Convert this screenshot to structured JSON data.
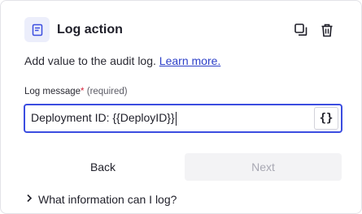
{
  "panel": {
    "title": "Log action",
    "icon": "log-icon",
    "actions": [
      {
        "name": "duplicate-icon"
      },
      {
        "name": "trash-icon"
      }
    ]
  },
  "description": {
    "text": "Add value to the audit log.",
    "link": "Learn more."
  },
  "field": {
    "label": "Log message",
    "required_mark": "*",
    "hint": "(required)",
    "value": "Deployment ID: {{DeployID}}",
    "variable_button": "{}"
  },
  "buttons": {
    "back": "Back",
    "next": "Next"
  },
  "disclosure": {
    "label": "What information can I log?"
  },
  "colors": {
    "accent": "#3b4de0",
    "link": "#2d40c8",
    "required": "#d7263d",
    "icon_badge_bg": "#eceefb",
    "disabled_bg": "#f3f3f5",
    "disabled_text": "#a8a8b3"
  }
}
